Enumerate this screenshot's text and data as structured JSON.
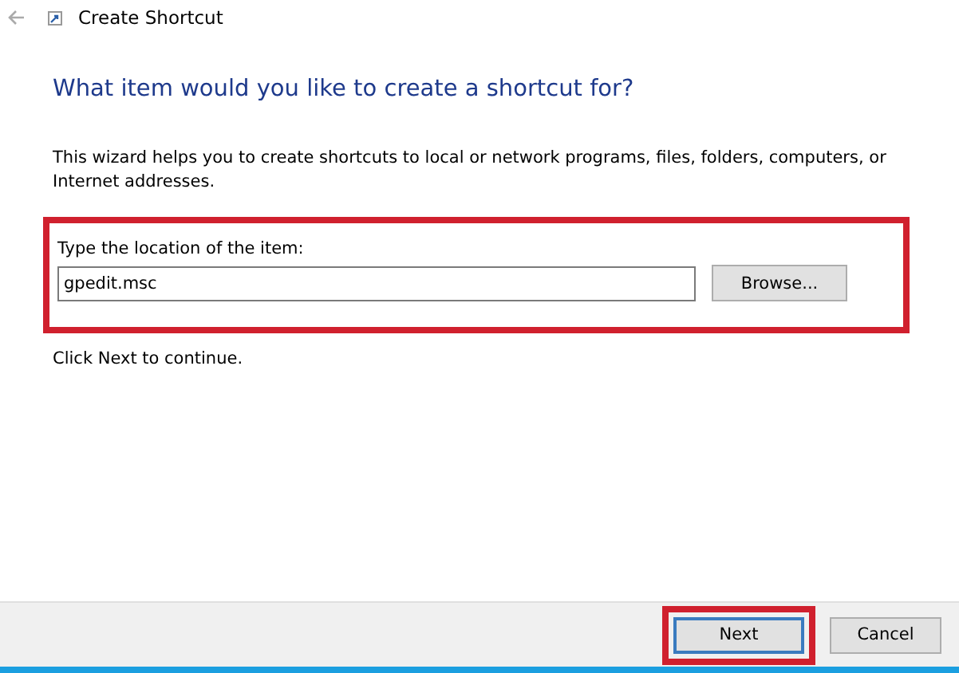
{
  "window": {
    "title": "Create Shortcut"
  },
  "heading": "What item would you like to create a shortcut for?",
  "description": "This wizard helps you to create shortcuts to local or network programs, files, folders, computers, or Internet addresses.",
  "location": {
    "label": "Type the location of the item:",
    "value": "gpedit.msc",
    "browse_button": "Browse...",
    "highlighted": true
  },
  "hint": "Click Next to continue.",
  "buttons": [
    {
      "label": "Next",
      "default": true,
      "highlighted": true
    },
    {
      "label": "Cancel",
      "default": false,
      "highlighted": false
    }
  ]
}
